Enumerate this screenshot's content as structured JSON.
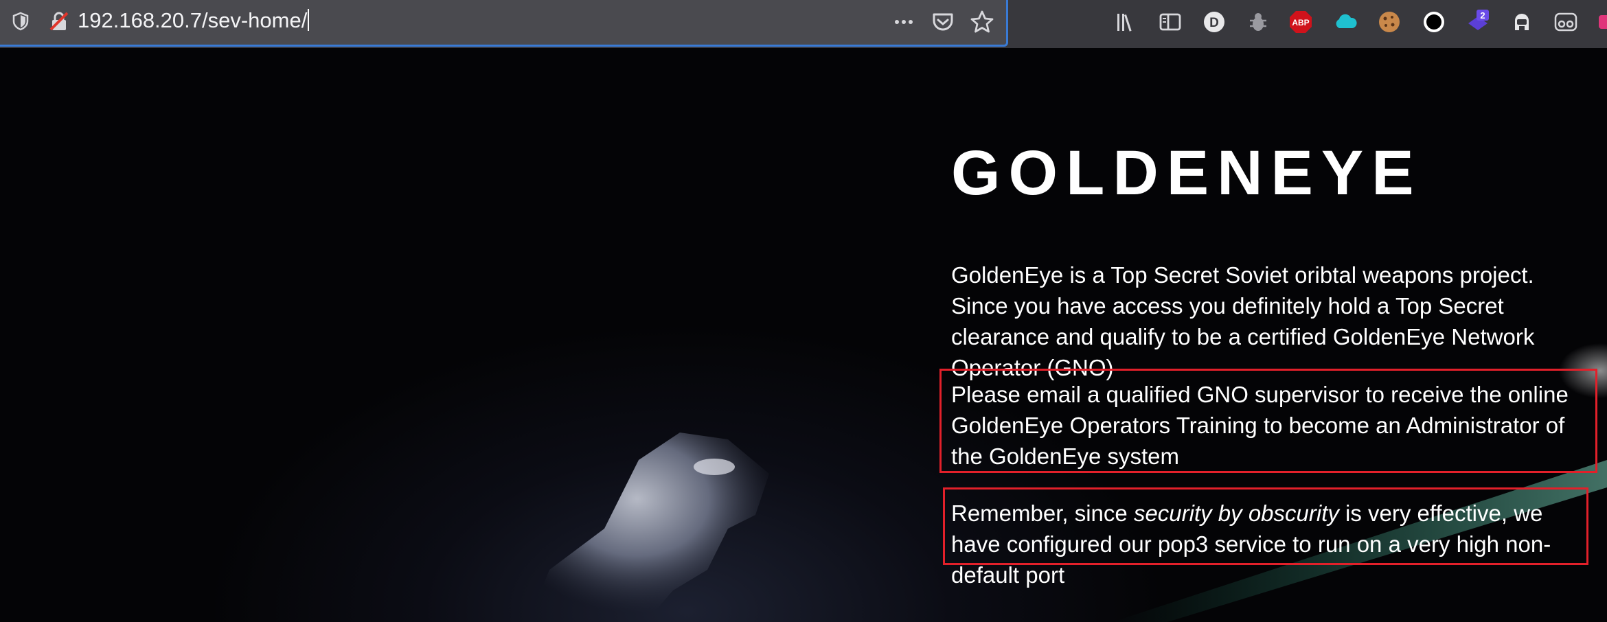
{
  "browser": {
    "url": "192.168.20.7/sev-home/",
    "icons": {
      "tracking_protection": "shield-icon",
      "insecure_connection": "insecure-lock-icon",
      "page_actions": "more-icon",
      "pocket": "pocket-icon",
      "bookmark": "star-icon",
      "library": "library-icon",
      "sidebar": "sidebar-icon",
      "extensions": [
        "d-extension-icon",
        "bug-extension-icon",
        "adblock-extension-icon",
        "cloud-extension-icon",
        "cookie-extension-icon",
        "circle-extension-icon",
        "badge-extension-icon",
        "robot-extension-icon",
        "glasses-extension-icon"
      ]
    },
    "badges": {
      "abp": "ABP",
      "d": "D",
      "extension_count": "2"
    }
  },
  "page": {
    "title": "GOLDENEYE",
    "paragraph1": "GoldenEye is a Top Secret Soviet oribtal weapons project. Since you have access you definitely hold a Top Secret clearance and qualify to be a certified GoldenEye Network Operator (GNO)",
    "paragraph2": "Please email a qualified GNO supervisor to receive the online GoldenEye Operators Training to become an Administrator of the GoldenEye system",
    "paragraph3": {
      "before": "Remember, since ",
      "emphasis": "security by obscurity",
      "after": " is very effective, we have configured our pop3 service to run on a very high non-default port"
    },
    "highlight_color": "#e2202a"
  }
}
